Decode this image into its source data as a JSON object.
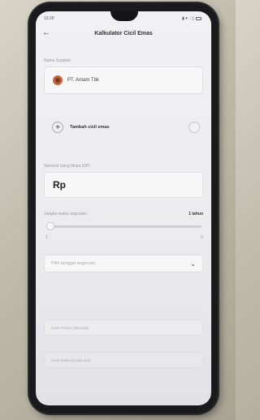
{
  "status_bar": {
    "time": "13.20",
    "icons": "▮ ▾ .⫶ ▯"
  },
  "header": {
    "title": "Kalkulator Cicil Emas"
  },
  "supplier": {
    "label": "Nama Supplier",
    "name": "PT. Antam Tbk"
  },
  "add_gold": {
    "label": "Tambah cicil emas"
  },
  "down_payment": {
    "label": "Nominal Uang Muka (DP)",
    "prefix": "Rp"
  },
  "tenor": {
    "label": "Jangka waktu angsuran",
    "value": "1 tahun",
    "min": "1",
    "max": "5",
    "level": 0
  },
  "installment_date": {
    "placeholder": "Pilih tanggal angsuran"
  },
  "promo_code": {
    "placeholder": "Kode Promo (Jika ada)"
  },
  "referral_code": {
    "placeholder": "Kode Referral (Jika ada)"
  },
  "colors": {
    "accent": "#c8643a",
    "background": "#f1f1f3"
  }
}
